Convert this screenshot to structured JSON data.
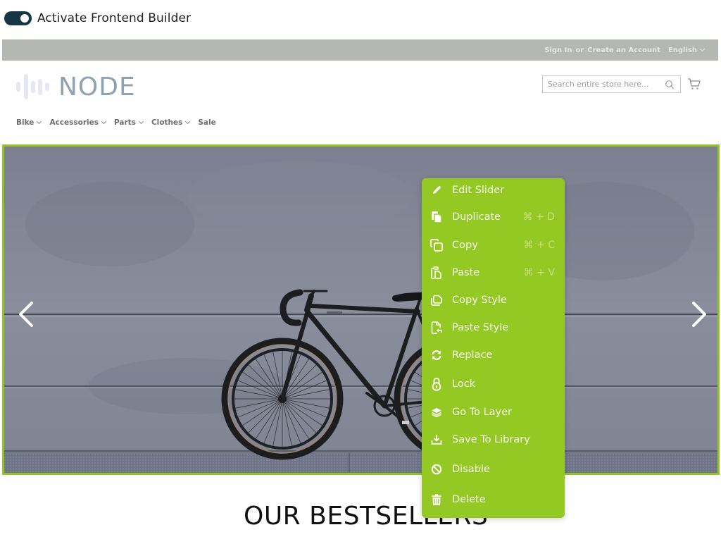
{
  "builder": {
    "toggle_on": true,
    "label": "Activate Frontend Builder"
  },
  "header": {
    "sign_in": "Sign In",
    "or": "or",
    "create_account": "Create an Account",
    "language": "English"
  },
  "logo": {
    "text": "NODE"
  },
  "search": {
    "placeholder": "Search entire store here..."
  },
  "nav": {
    "items": [
      {
        "label": "Bike",
        "has_dropdown": true
      },
      {
        "label": "Accessories",
        "has_dropdown": true
      },
      {
        "label": "Parts",
        "has_dropdown": true
      },
      {
        "label": "Clothes",
        "has_dropdown": true
      },
      {
        "label": "Sale",
        "has_dropdown": false
      }
    ]
  },
  "colors": {
    "accent_green": "#94c823",
    "toggle_dark": "#163646",
    "header_grey": "#b5b7b3",
    "logo_blue": "#8ea3b1"
  },
  "context_menu": {
    "items": [
      {
        "icon": "pencil-icon",
        "label": "Edit Slider",
        "shortcut": ""
      },
      {
        "icon": "duplicate-icon",
        "label": "Duplicate",
        "shortcut": "⌘ + D"
      },
      {
        "icon": "copy-icon",
        "label": "Copy",
        "shortcut": "⌘ + C"
      },
      {
        "icon": "paste-icon",
        "label": "Paste",
        "shortcut": "⌘ + V"
      },
      {
        "icon": "copy-style-icon",
        "label": "Copy Style",
        "shortcut": ""
      },
      {
        "icon": "paste-style-icon",
        "label": "Paste Style",
        "shortcut": ""
      },
      {
        "icon": "replace-icon",
        "label": "Replace",
        "shortcut": ""
      },
      {
        "icon": "lock-icon",
        "label": "Lock",
        "shortcut": ""
      },
      {
        "icon": "layers-icon",
        "label": "Go To Layer",
        "shortcut": ""
      },
      {
        "icon": "download-icon",
        "label": "Save To Library",
        "shortcut": ""
      },
      {
        "icon": "disable-icon",
        "label": "Disable",
        "shortcut": ""
      },
      {
        "icon": "trash-icon",
        "label": "Delete",
        "shortcut": ""
      }
    ]
  },
  "section": {
    "title": "OUR BESTSELLERS"
  }
}
